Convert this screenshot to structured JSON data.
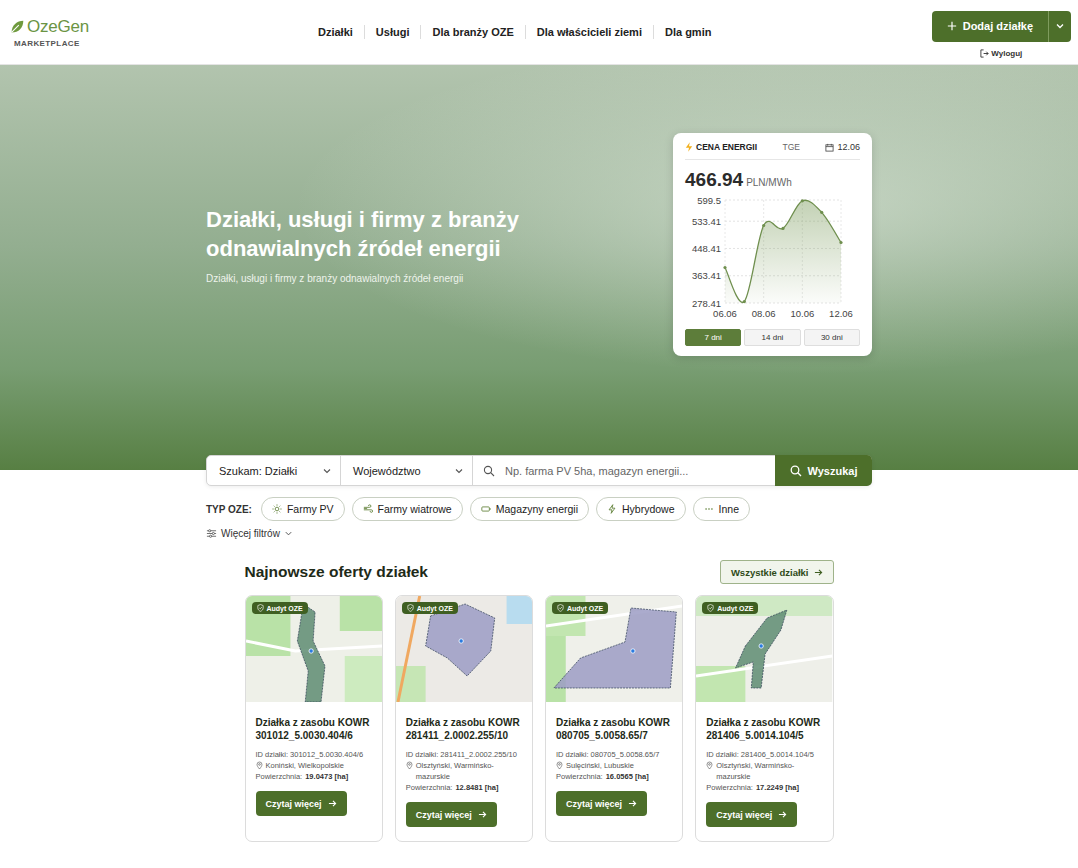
{
  "header": {
    "logo": {
      "name": "OzeGen",
      "tagline": "MARKETPLACE"
    },
    "nav": [
      "Działki",
      "Usługi",
      "Dla branży OZE",
      "Dla właścicieli ziemi",
      "Dla gmin"
    ],
    "add_button": "Dodaj działkę",
    "logout": "Wyloguj"
  },
  "hero": {
    "title_lines": [
      "Działki, usługi i firmy z branży",
      "odnawialnych źródeł energii"
    ],
    "subtitle": "Działki, usługi i firmy z branży odnawialnych źródeł energii"
  },
  "price_card": {
    "title": "CENA ENERGII",
    "source": "TGE",
    "date": "12.06",
    "price": "466.94",
    "unit": "PLN/MWh",
    "y_ticks": [
      "599.5",
      "533.41",
      "448.41",
      "363.41",
      "278.41"
    ],
    "x_ticks": [
      "06.06",
      "08.06",
      "10.06",
      "12.06"
    ],
    "series": [
      389,
      283,
      520,
      511,
      597,
      561,
      467
    ],
    "ranges": [
      {
        "label": "7 dni",
        "selected": true
      },
      {
        "label": "14 dni",
        "selected": false
      },
      {
        "label": "30 dni",
        "selected": false
      }
    ]
  },
  "search": {
    "type_select": "Szukam: Działki",
    "region_select": "Województwo",
    "placeholder": "Np. farma PV 5ha, magazyn energii...",
    "button": "Wyszukaj"
  },
  "filters": {
    "label": "TYP OZE:",
    "chips": [
      "Farmy PV",
      "Farmy wiatrowe",
      "Magazyny energii",
      "Hybrydowe",
      "Inne"
    ],
    "more": "Więcej filtrów"
  },
  "listings": {
    "title": "Najnowsze oferty działek",
    "all_button": "Wszystkie działki",
    "cards": [
      {
        "badge": "Audyt OZE",
        "title": "Działka z zasobu KOWR 301012_5.0030.404/6",
        "id": "ID działki: 301012_5.0030.404/6",
        "location": "Koniński, Wielkopolskie",
        "area_label": "Powierzchnia:",
        "area": "19.0473 [ha]",
        "button": "Czytaj więcej",
        "color": "#5e8c72"
      },
      {
        "badge": "Audyt OZE",
        "title": "Działka z zasobu KOWR 281411_2.0002.255/10",
        "id": "ID działki: 281411_2.0002.255/10",
        "location": "Olsztyński, Warmińsko-mazurskie",
        "area_label": "Powierzchnia:",
        "area": "12.8481 [ha]",
        "button": "Czytaj więcej",
        "color": "#9c9cc4"
      },
      {
        "badge": "Audyt OZE",
        "title": "Działka z zasobu KOWR 080705_5.0058.65/7",
        "id": "ID działki: 080705_5.0058.65/7",
        "location": "Sulęciński, Lubuskie",
        "area_label": "Powierzchnia:",
        "area": "16.0565 [ha]",
        "button": "Czytaj więcej",
        "color": "#9c9cc4"
      },
      {
        "badge": "Audyt OZE",
        "title": "Działka z zasobu KOWR 281406_5.0014.104/5",
        "id": "ID działki: 281406_5.0014.104/5",
        "location": "Olsztyński, Warmińsko-mazurskie",
        "area_label": "Powierzchnia:",
        "area": "17.2249 [ha]",
        "button": "Czytaj więcej",
        "color": "#5e8c72"
      }
    ]
  }
}
